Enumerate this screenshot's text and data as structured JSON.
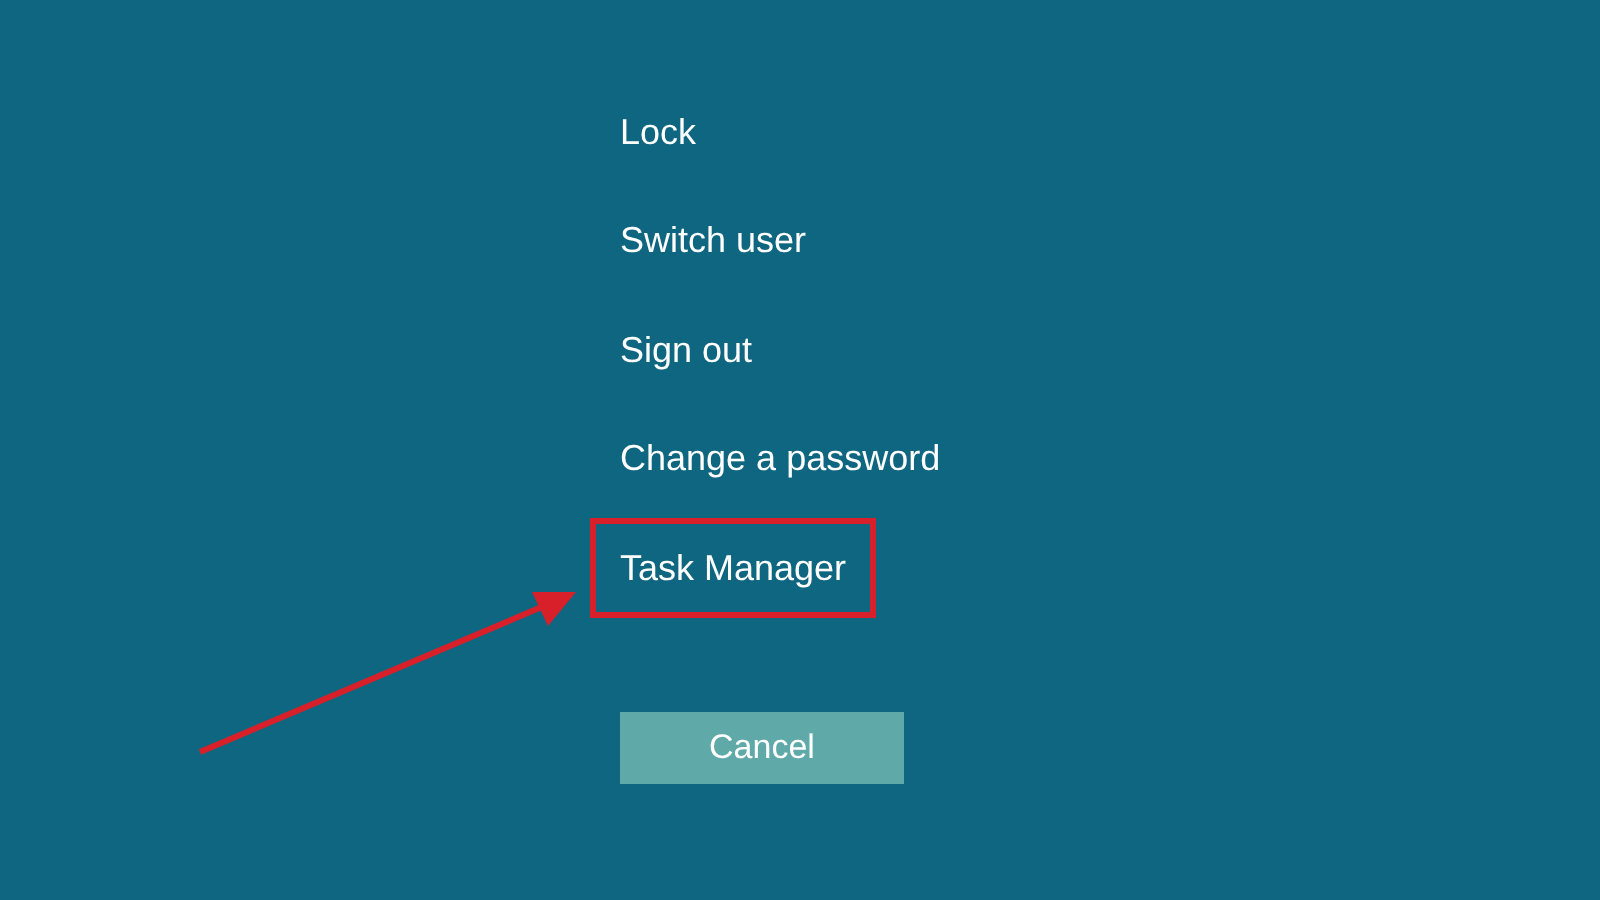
{
  "options": [
    {
      "label": "Lock",
      "highlighted": false
    },
    {
      "label": "Switch user",
      "highlighted": false
    },
    {
      "label": "Sign out",
      "highlighted": false
    },
    {
      "label": "Change a password",
      "highlighted": false
    },
    {
      "label": "Task Manager",
      "highlighted": true
    }
  ],
  "cancel_button": {
    "label": "Cancel"
  },
  "annotation_arrow": true
}
